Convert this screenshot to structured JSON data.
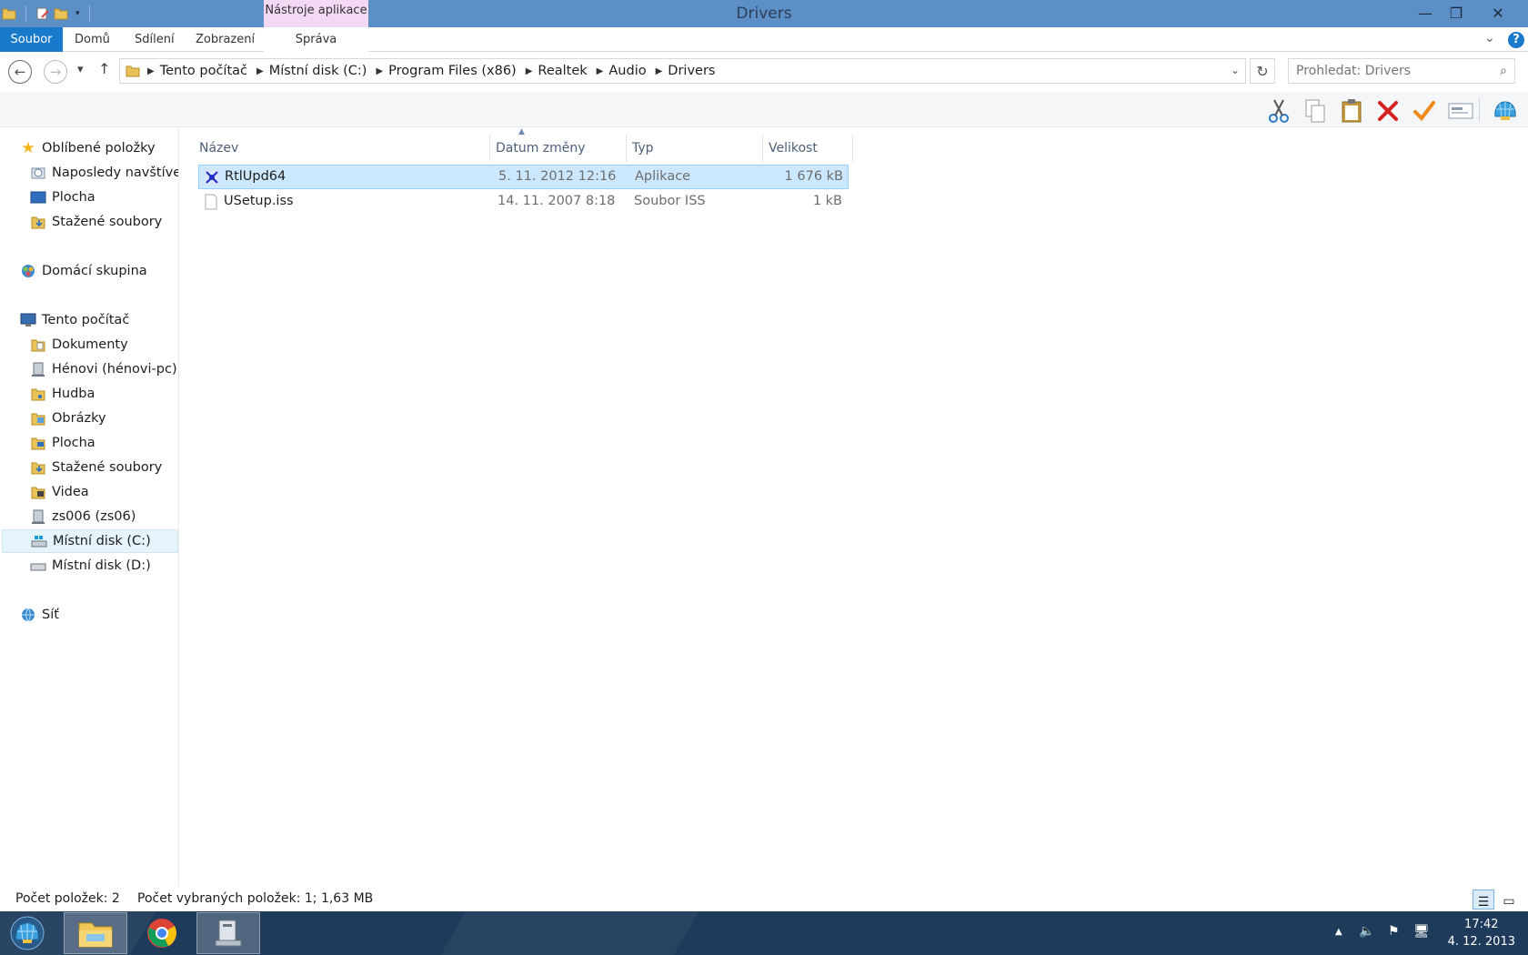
{
  "window": {
    "title": "Drivers",
    "context_tab_group": "Nástroje aplikace",
    "minimize_glyph": "—",
    "maximize_glyph": "❐",
    "close_glyph": "✕"
  },
  "ribbon": {
    "tabs": [
      "Soubor",
      "Domů",
      "Sdílení",
      "Zobrazení"
    ],
    "context_tab": "Správa",
    "help_glyph": "?"
  },
  "address": {
    "crumbs": [
      "Tento počítač",
      "Místní disk (C:)",
      "Program Files (x86)",
      "Realtek",
      "Audio",
      "Drivers"
    ],
    "search_placeholder": "Prohledat: Drivers"
  },
  "toolbar": {
    "icons": [
      "cut-icon",
      "copy-icon",
      "paste-icon",
      "delete-icon",
      "checkmark-icon",
      "rename-icon",
      "shell-icon"
    ]
  },
  "nav": {
    "favorites": "Oblíbené položky",
    "recent": "Naposledy navštívené",
    "desktop": "Plocha",
    "downloads": "Stažené soubory",
    "homegroup": "Domácí skupina",
    "this_pc": "Tento počítač",
    "documents": "Dokumenty",
    "henovi": "Hénovi (hénovi-pc)",
    "music": "Hudba",
    "pictures": "Obrázky",
    "desktop2": "Plocha",
    "downloads2": "Stažené soubory",
    "videos": "Videa",
    "zs006": "zs006 (zs06)",
    "disk_c": "Místní disk (C:)",
    "disk_d": "Místní disk (D:)",
    "network": "Síť"
  },
  "columns": {
    "name": "Název",
    "date": "Datum změny",
    "type": "Typ",
    "size": "Velikost"
  },
  "files": [
    {
      "name": "RtlUpd64",
      "date": "5. 11. 2012 12:16",
      "type": "Aplikace",
      "size": "1 676 kB"
    },
    {
      "name": "USetup.iss",
      "date": "14. 11. 2007 8:18",
      "type": "Soubor ISS",
      "size": "1 kB"
    }
  ],
  "status": {
    "count": "Počet položek: 2",
    "selected": "Počet vybraných položek: 1; 1,63 MB"
  },
  "clock": {
    "time": "17:42",
    "date": "4. 12. 2013"
  },
  "colors": {
    "titlebar": "#5b8fc6",
    "file_tab": "#1979ca",
    "selection": "#cce8ff",
    "taskbar": "#1f3b5b"
  }
}
